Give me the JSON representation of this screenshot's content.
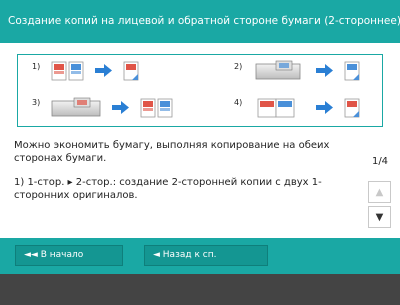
{
  "header": {
    "title": "Создание копий на лицевой и обратной стороне бумаги (2-стороннее)"
  },
  "diagram": {
    "modes": [
      {
        "number": "1)",
        "label": "1-стор. → 2-стор."
      },
      {
        "number": "2)",
        "label": "2-стор. → 2-стор."
      },
      {
        "number": "3)",
        "label": "2-стор. → 1-стор."
      },
      {
        "number": "4)",
        "label": "книга → 2-стор."
      }
    ],
    "colors": {
      "accent": "#1aa8a4",
      "arrow": "#2a7fd4",
      "page_red": "#e05548",
      "page_blue": "#4a90d9"
    }
  },
  "content": {
    "description": "Можно экономить бумагу, выполняя копирование на обеих сторонах бумаги.",
    "item_1": "1) 1-стор. ▸ 2-стор.: создание 2-сторонней копии с двух 1-сторонних оригиналов."
  },
  "pager": {
    "page_indicator": "1/4",
    "up_icon": "▲",
    "down_icon": "▼"
  },
  "footer": {
    "home_label": "◄◄ В начало",
    "back_label": "◄  Назад к сп."
  }
}
